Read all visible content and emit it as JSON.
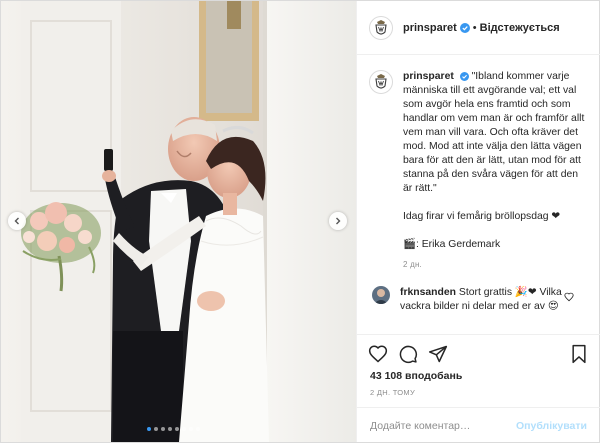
{
  "header": {
    "username": "prinsparet",
    "separator": "•",
    "follow_label": "Відстежується"
  },
  "caption": {
    "username": "prinsparet",
    "text": "\"Ibland kommer varje människa till ett avgörande val; ett val som avgör hela ens framtid och som handlar om vem man är och framför allt vem man vill vara. Och ofta kräver det mod. Mod att inte välja den lätta vägen bara för att den är lätt, utan mod för att stanna på den svåra vägen för att den är rätt.\"\n\nIdag firar vi femårig bröllopsdag ❤\n\n🎬: Erika Gerdemark",
    "time": "2 дн."
  },
  "comments": [
    {
      "username": "frknsanden",
      "text": "Stort grattis 🎉❤ Vilka vackra bilder ni delar med er av 😍"
    }
  ],
  "actions": {
    "likes": "43 108 вподобань",
    "time": "2 ДН. ТОМУ"
  },
  "add_comment": {
    "placeholder": "Додайте коментар…",
    "publish_label": "Опублікувати"
  },
  "carousel": {
    "slide_count": 8,
    "active_index": 0
  },
  "colors": {
    "verified_blue": "#3897f0",
    "heart_red": "#ed4956",
    "publish_disabled": "#b2dffc",
    "muted_text": "#8e8e8e"
  },
  "icons": [
    "crest-icon",
    "verified-icon",
    "heart-icon",
    "comment-icon",
    "share-icon",
    "bookmark-icon",
    "chevron-left-icon",
    "chevron-right-icon"
  ]
}
